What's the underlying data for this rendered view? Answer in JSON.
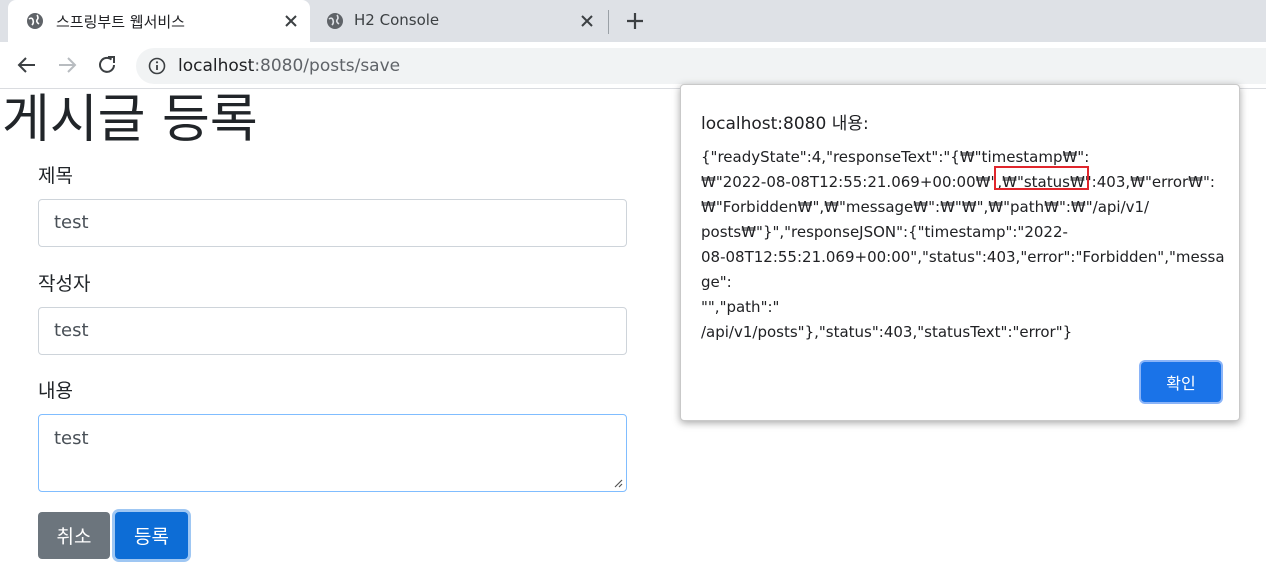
{
  "browser": {
    "tabs": [
      {
        "title": "스프링부트 웹서비스",
        "active": true
      },
      {
        "title": "H2 Console",
        "active": false
      }
    ],
    "url_host": "localhost",
    "url_rest": ":8080/posts/save"
  },
  "page": {
    "title": "게시글 등록",
    "fields": {
      "title": {
        "label": "제목",
        "value": "test"
      },
      "author": {
        "label": "작성자",
        "value": "test"
      },
      "content": {
        "label": "내용",
        "value": "test"
      }
    },
    "buttons": {
      "cancel": "취소",
      "save": "등록"
    }
  },
  "dialog": {
    "title": "localhost:8080 내용:",
    "message": "{\"readyState\":4,\"responseText\":\"{₩\"timestamp₩\":\n₩\"2022-08-08T12:55:21.069+00:00₩\",₩\"status₩\":403,₩\"error₩\":\n₩\"Forbidden₩\",₩\"message₩\":₩\"₩\",₩\"path₩\":₩\"/api/v1/\nposts₩\"}\",\"responseJSON\":{\"timestamp\":\"2022-\n08-08T12:55:21.069+00:00\",\"status\":403,\"error\":\"Forbidden\",\"message\":\n\"\",\"path\":\"\n/api/v1/posts\"},\"status\":403,\"statusText\":\"error\"}",
    "ok_label": "확인"
  },
  "colors": {
    "primary": "#0d6dd6",
    "secondary": "#6c757d",
    "highlight": "#e0262c",
    "dialog_button": "#1a73e8"
  }
}
